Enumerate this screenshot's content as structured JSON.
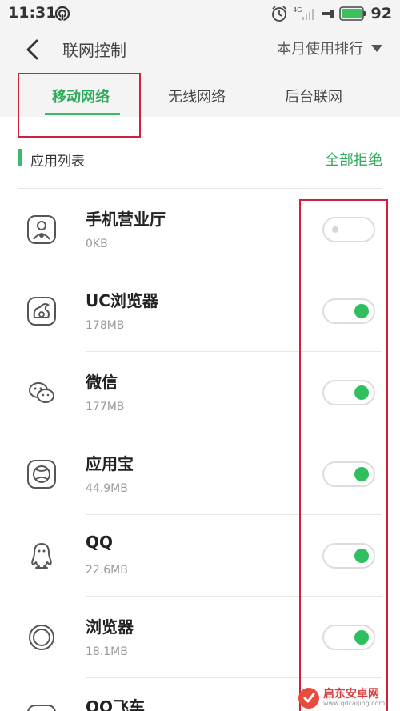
{
  "status_bar": {
    "time": "11:31",
    "signal_label": "4G",
    "battery": "92"
  },
  "header": {
    "title": "联网控制",
    "sort_label": "本月使用排行"
  },
  "tabs": [
    {
      "label": "移动网络",
      "active": true
    },
    {
      "label": "无线网络",
      "active": false
    },
    {
      "label": "后台联网",
      "active": false
    }
  ],
  "section": {
    "title": "应用列表",
    "deny_all": "全部拒绝"
  },
  "apps": [
    {
      "name": "手机营业厅",
      "usage": "0KB",
      "enabled": false,
      "icon": "phone-hall-icon"
    },
    {
      "name": "UC浏览器",
      "usage": "178MB",
      "enabled": true,
      "icon": "uc-browser-icon"
    },
    {
      "name": "微信",
      "usage": "177MB",
      "enabled": true,
      "icon": "wechat-icon"
    },
    {
      "name": "应用宝",
      "usage": "44.9MB",
      "enabled": true,
      "icon": "app-store-icon"
    },
    {
      "name": "QQ",
      "usage": "22.6MB",
      "enabled": true,
      "icon": "qq-icon"
    },
    {
      "name": "浏览器",
      "usage": "18.1MB",
      "enabled": true,
      "icon": "browser-icon"
    },
    {
      "name": "QQ飞车",
      "usage": "",
      "enabled": true,
      "icon": "qq-speed-icon"
    }
  ],
  "watermark": {
    "text": "启东安卓网",
    "sub": "www.qdcaijing.com"
  },
  "colors": {
    "accent": "#3cb96b",
    "highlight": "#d0223a"
  }
}
